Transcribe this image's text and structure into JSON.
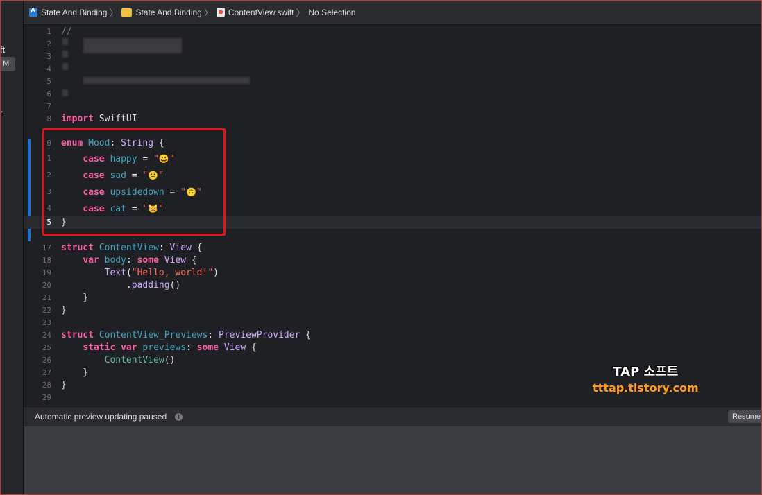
{
  "sidebar": {
    "partial_label": "ft",
    "badge": "M",
    "dot": "."
  },
  "breadcrumb": {
    "project": "State And Binding",
    "group": "State And Binding",
    "file": "ContentView.swift",
    "selection": "No Selection"
  },
  "editor": {
    "current_line": 15,
    "lines": [
      {
        "n": "1",
        "text": "//"
      },
      {
        "n": "2",
        "text": ""
      },
      {
        "n": "3",
        "text": ""
      },
      {
        "n": "4",
        "text": ""
      },
      {
        "n": "5",
        "text": ""
      },
      {
        "n": "6",
        "text": ""
      },
      {
        "n": "7",
        "text": ""
      },
      {
        "n": "8",
        "text": "import SwiftUI"
      },
      {
        "n": "0",
        "text": "enum Mood: String {"
      },
      {
        "n": "1",
        "text": "case happy = \"😀\""
      },
      {
        "n": "2",
        "text": "case sad = \"☹️\""
      },
      {
        "n": "3",
        "text": "case upsidedown = \"🙃\""
      },
      {
        "n": "4",
        "text": "case cat = \"🐱\""
      },
      {
        "n": "5",
        "text": "}"
      },
      {
        "n": "17",
        "text": "struct ContentView: View {"
      },
      {
        "n": "18",
        "text": "var body: some View {"
      },
      {
        "n": "19",
        "text": "Text(\"Hello, world!\")"
      },
      {
        "n": "20",
        "text": ".padding()"
      },
      {
        "n": "21",
        "text": "}"
      },
      {
        "n": "22",
        "text": "}"
      },
      {
        "n": "23",
        "text": ""
      },
      {
        "n": "24",
        "text": "struct ContentView_Previews: PreviewProvider {"
      },
      {
        "n": "25",
        "text": "static var previews: some View {"
      },
      {
        "n": "26",
        "text": "ContentView()"
      },
      {
        "n": "27",
        "text": "}"
      },
      {
        "n": "28",
        "text": "}"
      },
      {
        "n": "29",
        "text": ""
      }
    ]
  },
  "watermark": {
    "title": "TAP 소프트",
    "url": "tttap.tistory.com"
  },
  "statusbar": {
    "message": "Automatic preview updating paused",
    "info_icon": "i",
    "resume_label": "Resume"
  },
  "colors": {
    "keyword": "#fc5fa3",
    "type": "#d0a8ff",
    "declaration": "#41a1c0",
    "string": "#fc6a5d",
    "highlight_box": "#e4151c",
    "change_bar": "#1f6fd1"
  }
}
